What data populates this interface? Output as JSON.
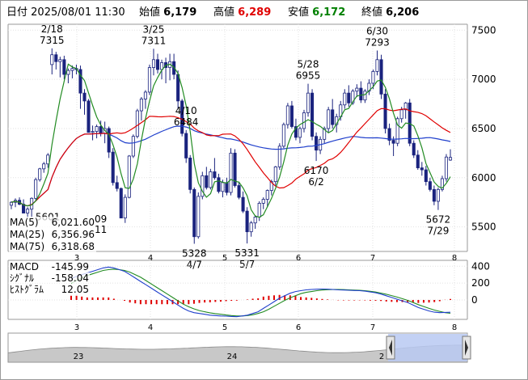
{
  "header": {
    "date_label": "日付",
    "datetime": "2025/08/01 11:30",
    "open_label": "始値",
    "open_value": "6,179",
    "high_label": "高値",
    "high_value": "6,289",
    "low_label": "安値",
    "low_value": "6,172",
    "close_label": "終値",
    "close_value": "6,206"
  },
  "colors": {
    "candle_up": "#ffffff",
    "candle_down": "#1a237e",
    "ma5": "#228b22",
    "ma25": "#e00000",
    "ma75": "#1f3fcc",
    "macd": "#1f3fcc",
    "signal": "#228b22",
    "histogram": "#e00000"
  },
  "legend": [
    {
      "label": "MA(5)",
      "value": "6,021.60",
      "color": "#228b22"
    },
    {
      "label": "MA(25)",
      "value": "6,356.96",
      "color": "#e00000"
    },
    {
      "label": "MA(75)",
      "value": "6,318.68",
      "color": "#1f3fcc"
    }
  ],
  "macd_legend": [
    {
      "label": "MACD",
      "value": "-145.99",
      "color": "#1f3fcc"
    },
    {
      "label": "ｼｸﾞﾅﾙ",
      "value": "-158.04",
      "color": "#228b22"
    },
    {
      "label": "ﾋｽﾄｸﾞﾗﾑ",
      "value": "12.05",
      "color": "#e00000"
    }
  ],
  "annotations": [
    {
      "date": "2/18",
      "value": "7315",
      "kind": "high"
    },
    {
      "date": "3/25",
      "value": "7311",
      "kind": "high"
    },
    {
      "date": "4/10",
      "value": "6484",
      "kind": "high"
    },
    {
      "date": "5/28",
      "value": "6955",
      "kind": "high"
    },
    {
      "date": "6/30",
      "value": "7293",
      "kind": "high"
    },
    {
      "date": "4/7",
      "value": "5328",
      "kind": "low"
    },
    {
      "date": "5/7",
      "value": "5331",
      "kind": "low"
    },
    {
      "date": "6/2",
      "value": "6170",
      "kind": "low"
    },
    {
      "date": "7/29",
      "value": "5672",
      "kind": "low"
    },
    {
      "date": "",
      "value": "5601",
      "kind": "low"
    }
  ],
  "partial_label": {
    "top": "09",
    "bottom": "11"
  },
  "navigator": {
    "labels": [
      "23",
      "24",
      "2"
    ]
  },
  "chart_data": [
    {
      "type": "candlestick",
      "title": "",
      "x_tick_labels": [
        "3",
        "4",
        "5",
        "6",
        "7",
        "8"
      ],
      "y_tick_labels": [
        "7500",
        "7000",
        "6500",
        "6000",
        "5500"
      ],
      "ylim": [
        5250,
        7560
      ],
      "grid": true,
      "legend_position": "bottom-left",
      "candles": [
        [
          5720,
          5760,
          5680,
          5750
        ],
        [
          5750,
          5790,
          5700,
          5770
        ],
        [
          5770,
          5800,
          5720,
          5730
        ],
        [
          5730,
          5780,
          5650,
          5640
        ],
        [
          5640,
          5700,
          5600,
          5680
        ],
        [
          5680,
          5800,
          5601,
          5790
        ],
        [
          5790,
          6000,
          5770,
          5980
        ],
        [
          5980,
          6100,
          5960,
          6090
        ],
        [
          6090,
          6160,
          6050,
          6140
        ],
        [
          6140,
          6250,
          6100,
          6230
        ],
        [
          7150,
          7315,
          7050,
          7250
        ],
        [
          7250,
          7280,
          7100,
          7180
        ],
        [
          7180,
          7230,
          7020,
          7200
        ],
        [
          7200,
          7240,
          7000,
          7050
        ],
        [
          7050,
          7110,
          6960,
          7090
        ],
        [
          7090,
          7140,
          7010,
          7110
        ],
        [
          7110,
          7150,
          7050,
          7100
        ],
        [
          7100,
          7140,
          6700,
          6860
        ],
        [
          6860,
          6900,
          6640,
          6780
        ],
        [
          6780,
          6800,
          6520,
          6460
        ],
        [
          6460,
          6530,
          6380,
          6470
        ],
        [
          6470,
          6540,
          6400,
          6520
        ],
        [
          6520,
          6580,
          6420,
          6450
        ],
        [
          6450,
          6570,
          6350,
          6500
        ],
        [
          6500,
          6520,
          6200,
          6260
        ],
        [
          6260,
          6300,
          5920,
          5950
        ],
        [
          5950,
          6020,
          5860,
          5890
        ],
        [
          5890,
          5900,
          5610,
          5590
        ],
        [
          5590,
          5830,
          5540,
          5800
        ],
        [
          5800,
          6230,
          5790,
          6220
        ],
        [
          6220,
          6440,
          6200,
          6420
        ],
        [
          6420,
          6700,
          6400,
          6680
        ],
        [
          6680,
          6820,
          6580,
          6800
        ],
        [
          6800,
          6890,
          6700,
          6870
        ],
        [
          6870,
          7150,
          6840,
          7120
        ],
        [
          7120,
          7311,
          7040,
          7200
        ],
        [
          7200,
          7260,
          7060,
          7100
        ],
        [
          7100,
          7200,
          7000,
          7170
        ],
        [
          7170,
          7220,
          6960,
          7120
        ],
        [
          7120,
          7260,
          6990,
          7180
        ],
        [
          7180,
          7260,
          7000,
          7050
        ],
        [
          7050,
          7090,
          6700,
          6780
        ],
        [
          6780,
          6800,
          6420,
          6450
        ],
        [
          6450,
          6484,
          6150,
          6200
        ],
        [
          6200,
          6230,
          5840,
          5880
        ],
        [
          5880,
          5900,
          5328,
          5400
        ],
        [
          5400,
          5850,
          5380,
          5810
        ],
        [
          5810,
          6060,
          5780,
          6020
        ],
        [
          6020,
          6110,
          5880,
          5900
        ],
        [
          5900,
          6090,
          5880,
          6060
        ],
        [
          6060,
          6200,
          5980,
          6000
        ],
        [
          6000,
          6040,
          5840,
          5860
        ],
        [
          5860,
          5980,
          5800,
          5950
        ],
        [
          5950,
          6000,
          5820,
          5850
        ],
        [
          5850,
          6300,
          5820,
          6250
        ],
        [
          6250,
          6290,
          5900,
          5920
        ],
        [
          5920,
          5960,
          5780,
          5800
        ],
        [
          5800,
          5860,
          5640,
          5660
        ],
        [
          5660,
          5700,
          5331,
          5450
        ],
        [
          5450,
          5560,
          5400,
          5540
        ],
        [
          5540,
          5620,
          5480,
          5600
        ],
        [
          5600,
          5760,
          5560,
          5740
        ],
        [
          5740,
          5800,
          5680,
          5780
        ],
        [
          5780,
          5880,
          5700,
          5870
        ],
        [
          5870,
          5980,
          5820,
          5960
        ],
        [
          5960,
          6120,
          5920,
          6110
        ],
        [
          6110,
          6350,
          6080,
          6320
        ],
        [
          6320,
          6560,
          6300,
          6540
        ],
        [
          6540,
          6760,
          6500,
          6730
        ],
        [
          6730,
          6780,
          6500,
          6520
        ],
        [
          6520,
          6600,
          6380,
          6410
        ],
        [
          6410,
          6520,
          6350,
          6500
        ],
        [
          6500,
          6690,
          6460,
          6660
        ],
        [
          6660,
          6955,
          6620,
          6860
        ],
        [
          6860,
          6900,
          6380,
          6420
        ],
        [
          6420,
          6460,
          6170,
          6280
        ],
        [
          6280,
          6420,
          6240,
          6390
        ],
        [
          6390,
          6520,
          6350,
          6500
        ],
        [
          6500,
          6720,
          6460,
          6690
        ],
        [
          6690,
          6800,
          6500,
          6540
        ],
        [
          6540,
          6650,
          6460,
          6620
        ],
        [
          6620,
          6780,
          6580,
          6740
        ],
        [
          6740,
          6900,
          6700,
          6860
        ],
        [
          6860,
          6940,
          6720,
          6760
        ],
        [
          6760,
          6900,
          6740,
          6880
        ],
        [
          6880,
          6950,
          6820,
          6910
        ],
        [
          6910,
          6980,
          6760,
          6790
        ],
        [
          6790,
          6900,
          6760,
          6880
        ],
        [
          6880,
          7000,
          6840,
          6960
        ],
        [
          6960,
          7100,
          6900,
          7080
        ],
        [
          7080,
          7293,
          7040,
          7200
        ],
        [
          7200,
          7250,
          6800,
          6850
        ],
        [
          6850,
          6900,
          6450,
          6500
        ],
        [
          6500,
          6550,
          6330,
          6380
        ],
        [
          6380,
          6420,
          6220,
          6350
        ],
        [
          6350,
          6620,
          6320,
          6600
        ],
        [
          6600,
          6720,
          6560,
          6690
        ],
        [
          6690,
          6770,
          6600,
          6760
        ],
        [
          6760,
          6800,
          6320,
          6350
        ],
        [
          6350,
          6380,
          6200,
          6230
        ],
        [
          6230,
          6280,
          6080,
          6100
        ],
        [
          6100,
          6160,
          6020,
          6080
        ],
        [
          6080,
          6120,
          5920,
          5960
        ],
        [
          5960,
          6000,
          5860,
          5880
        ],
        [
          5880,
          5920,
          5720,
          5760
        ],
        [
          5760,
          5900,
          5672,
          5880
        ],
        [
          5880,
          6020,
          5860,
          5990
        ],
        [
          5990,
          6240,
          5960,
          6210
        ],
        [
          6179,
          6289,
          6172,
          6206
        ]
      ]
    },
    {
      "type": "line",
      "title": "",
      "x_tick_labels": [
        "3",
        "4",
        "5",
        "6",
        "7",
        "8"
      ],
      "y_tick_labels": [
        "400",
        "200",
        "0"
      ],
      "ylim": [
        -230,
        470
      ],
      "series": [
        {
          "name": "MACD",
          "values": [
            250,
            280,
            300,
            320,
            340,
            360,
            380,
            390,
            380,
            360,
            340,
            300,
            260,
            220,
            180,
            140,
            100,
            60,
            20,
            -20,
            -60,
            -100,
            -130,
            -150,
            -160,
            -170,
            -180,
            -185,
            -190,
            -192,
            -195,
            -198,
            -190,
            -180,
            -160,
            -140,
            -100,
            -60,
            -20,
            20,
            50,
            80,
            100,
            110,
            120,
            125,
            128,
            130,
            128,
            125,
            120,
            118,
            115,
            112,
            110,
            105,
            95,
            85,
            70,
            50,
            30,
            10,
            -10,
            -30,
            -60,
            -90,
            -110,
            -130,
            -145,
            -150,
            -148,
            -146
          ]
        },
        {
          "name": "ｼｸﾞﾅﾙ",
          "values": [
            200,
            230,
            260,
            290,
            310,
            330,
            350,
            360,
            365,
            360,
            350,
            330,
            300,
            270,
            230,
            190,
            150,
            110,
            70,
            30,
            -10,
            -50,
            -80,
            -105,
            -125,
            -140,
            -152,
            -162,
            -170,
            -178,
            -185,
            -190,
            -190,
            -185,
            -175,
            -160,
            -140,
            -110,
            -75,
            -40,
            -5,
            25,
            50,
            75,
            90,
            100,
            110,
            118,
            122,
            124,
            124,
            123,
            120,
            117,
            114,
            110,
            103,
            94,
            82,
            68,
            52,
            35,
            15,
            -5,
            -30,
            -55,
            -78,
            -100,
            -120,
            -135,
            -150,
            -158
          ]
        },
        {
          "name": "ﾋｽﾄｸﾞﾗﾑ",
          "values": [
            50,
            50,
            40,
            30,
            30,
            30,
            30,
            30,
            15,
            0,
            -10,
            -30,
            -40,
            -50,
            -50,
            -50,
            -50,
            -50,
            -50,
            -50,
            -50,
            -50,
            -50,
            -45,
            -35,
            -30,
            -28,
            -23,
            -20,
            -14,
            -10,
            -8,
            0,
            5,
            15,
            20,
            40,
            50,
            55,
            60,
            55,
            55,
            50,
            35,
            30,
            25,
            18,
            12,
            6,
            1,
            -4,
            -5,
            -5,
            -5,
            -4,
            -5,
            -8,
            -9,
            -12,
            -18,
            -22,
            -25,
            -25,
            -25,
            -30,
            -35,
            -32,
            -30,
            -25,
            -15,
            2,
            12
          ]
        }
      ]
    }
  ]
}
